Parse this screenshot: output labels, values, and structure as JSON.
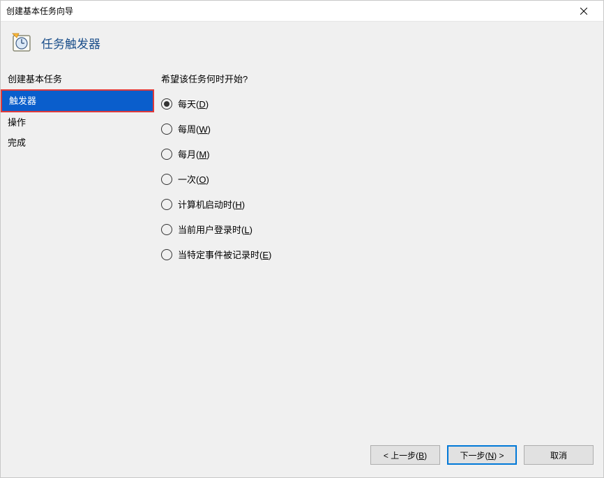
{
  "window": {
    "title": "创建基本任务向导"
  },
  "header": {
    "heading": "任务触发器"
  },
  "sidebar": {
    "items": [
      {
        "label": "创建基本任务",
        "selected": false
      },
      {
        "label": "触发器",
        "selected": true
      },
      {
        "label": "操作",
        "selected": false
      },
      {
        "label": "完成",
        "selected": false
      }
    ]
  },
  "content": {
    "prompt": "希望该任务何时开始?",
    "options": [
      {
        "text": "每天",
        "mnemonic": "D",
        "checked": true
      },
      {
        "text": "每周",
        "mnemonic": "W",
        "checked": false
      },
      {
        "text": "每月",
        "mnemonic": "M",
        "checked": false
      },
      {
        "text": "一次",
        "mnemonic": "O",
        "checked": false
      },
      {
        "text": "计算机启动时",
        "mnemonic": "H",
        "checked": false
      },
      {
        "text": "当前用户登录时",
        "mnemonic": "L",
        "checked": false
      },
      {
        "text": "当特定事件被记录时",
        "mnemonic": "E",
        "checked": false
      }
    ]
  },
  "footer": {
    "back": {
      "prefix": "< 上一步(",
      "mnemonic": "B",
      "suffix": ")"
    },
    "next": {
      "prefix": "下一步(",
      "mnemonic": "N",
      "suffix": ") >"
    },
    "cancel": {
      "label": "取消"
    }
  }
}
